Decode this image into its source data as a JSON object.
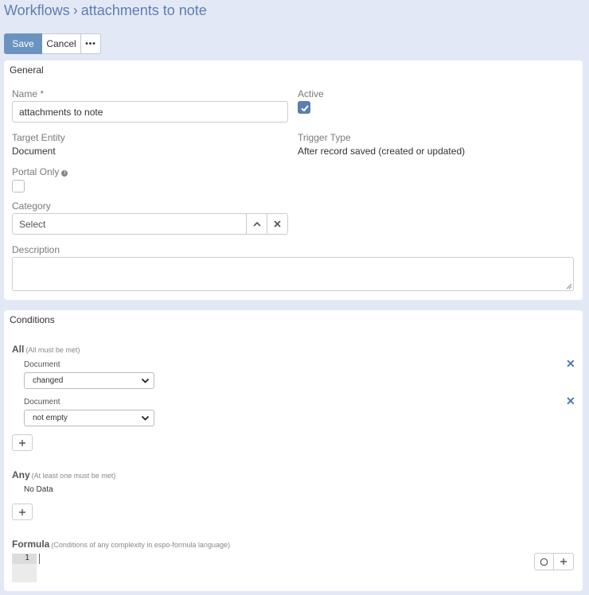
{
  "header": {
    "root": "Workflows",
    "separator": "›",
    "record": "attachments to note"
  },
  "toolbar": {
    "save_label": "Save",
    "cancel_label": "Cancel",
    "more_label": "•••"
  },
  "general": {
    "title": "General",
    "name_label": "Name *",
    "name_value": "attachments to note",
    "active_label": "Active",
    "active_checked": true,
    "target_entity_label": "Target Entity",
    "target_entity_value": "Document",
    "trigger_type_label": "Trigger Type",
    "trigger_type_value": "After record saved (created or updated)",
    "portal_only_label": "Portal Only",
    "portal_only_checked": false,
    "category_label": "Category",
    "category_placeholder": "Select",
    "description_label": "Description"
  },
  "conditions": {
    "title": "Conditions",
    "all_label": "All",
    "all_hint": "(All must be met)",
    "all_items": [
      {
        "entity": "Document",
        "operator": "changed"
      },
      {
        "entity": "Document",
        "operator": "not empty"
      }
    ],
    "any_label": "Any",
    "any_hint": "(At least one must be met)",
    "any_empty": "No Data",
    "formula_label": "Formula",
    "formula_hint": "(Conditions of any complexity in espo-formula language)",
    "formula_line": "1"
  },
  "colors": {
    "accent": "#6b93c0",
    "link": "#5b7fb0",
    "background": "#e3e8f7"
  }
}
